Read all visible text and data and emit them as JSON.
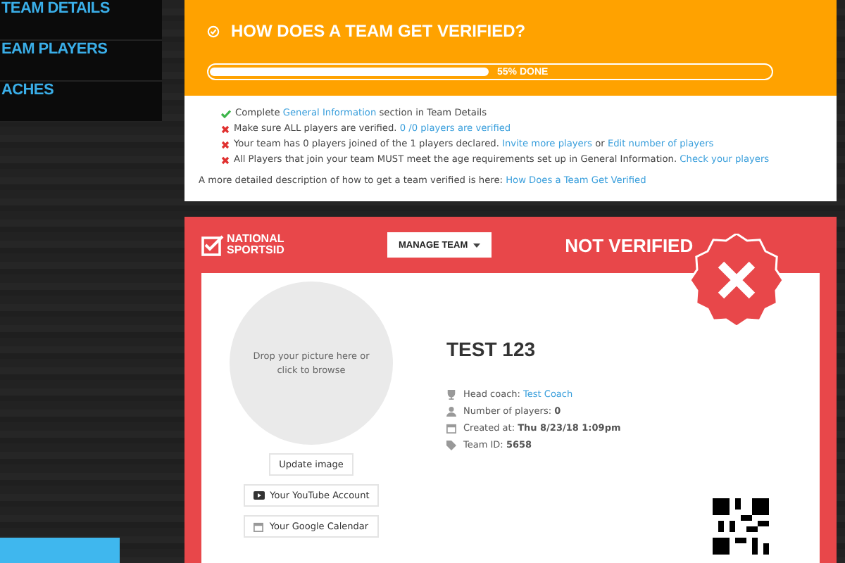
{
  "sidebar": {
    "items": [
      {
        "label": "TEAM DETAILS"
      },
      {
        "label": "EAM PLAYERS"
      },
      {
        "label": "ACHES"
      }
    ]
  },
  "verify_card": {
    "title": "HOW DOES A TEAM GET VERIFIED?",
    "progress": {
      "level": 0.55,
      "label": "55% DONE"
    },
    "checklist": [
      {
        "done": true,
        "parts": [
          {
            "text": "Complete "
          },
          {
            "text": "General Information",
            "link": true
          },
          {
            "text": " section in Team Details"
          }
        ]
      },
      {
        "done": false,
        "parts": [
          {
            "text": "Make sure ALL players are verified. "
          },
          {
            "text": "0 /0 players are verified",
            "link": true
          }
        ]
      },
      {
        "done": false,
        "parts": [
          {
            "text": "Your team has 0 players joined of the 1 players declared. "
          },
          {
            "text": "Invite more players",
            "link": true
          },
          {
            "text": " or "
          },
          {
            "text": "Edit number of players",
            "link": true
          }
        ]
      },
      {
        "done": false,
        "parts": [
          {
            "text": "All Players that join your team MUST meet the age requirements set up in General Information. "
          },
          {
            "text": "Check your players",
            "link": true
          }
        ]
      }
    ],
    "footer": [
      {
        "text": "A more detailed description of how to get a team verified is here: "
      },
      {
        "text": "How Does a Team Get Verified",
        "link": true
      }
    ]
  },
  "team_card": {
    "logo": [
      "NATIONAL",
      "SPORTSID"
    ],
    "manage_button": "MANAGE TEAM",
    "status": "NOT VERIFIED",
    "verified": false,
    "dropzone": "Drop your picture here or click to browse",
    "update_button": "Update image",
    "buttons": [
      {
        "kind": "youtube",
        "label": "Your YouTube Account"
      },
      {
        "kind": "calendar",
        "label": "Your Google Calendar"
      }
    ],
    "name": "TEST 123",
    "info": [
      {
        "kind": "trophy",
        "label": "Head coach: ",
        "value": "Test Coach",
        "link": true
      },
      {
        "kind": "user",
        "label": "Number of players: ",
        "value": "0",
        "link": false
      },
      {
        "kind": "calendar",
        "label": "Created at: ",
        "value": "Thu 8/23/18 1:09pm",
        "link": false
      },
      {
        "kind": "tag",
        "label": "Team ID: ",
        "value": "5658",
        "link": false
      }
    ]
  }
}
